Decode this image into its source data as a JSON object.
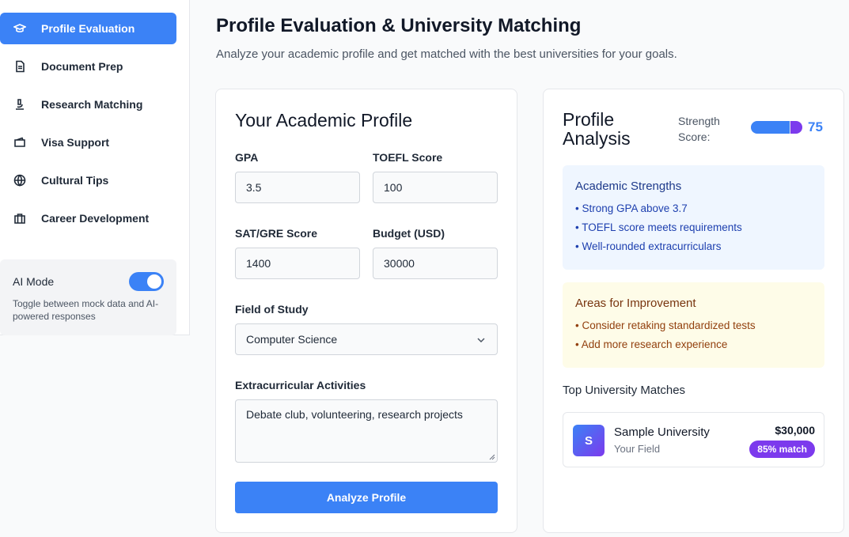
{
  "sidebar": {
    "items": [
      {
        "label": "Profile Evaluation",
        "icon": "graduation-cap-icon",
        "active": true
      },
      {
        "label": "Document Prep",
        "icon": "document-icon",
        "active": false
      },
      {
        "label": "Research Matching",
        "icon": "microscope-icon",
        "active": false
      },
      {
        "label": "Visa Support",
        "icon": "wallet-icon",
        "active": false
      },
      {
        "label": "Cultural Tips",
        "icon": "globe-icon",
        "active": false
      },
      {
        "label": "Career Development",
        "icon": "briefcase-icon",
        "active": false
      }
    ],
    "ai_mode": {
      "title": "AI Mode",
      "enabled": true,
      "description": "Toggle between mock data and AI-powered responses"
    }
  },
  "header": {
    "title": "Profile Evaluation & University Matching",
    "subtitle": "Analyze your academic profile and get matched with the best universities for your goals."
  },
  "form": {
    "title": "Your Academic Profile",
    "gpa": {
      "label": "GPA",
      "value": "3.5"
    },
    "toefl": {
      "label": "TOEFL Score",
      "value": "100"
    },
    "sat": {
      "label": "SAT/GRE Score",
      "value": "1400"
    },
    "budget": {
      "label": "Budget (USD)",
      "value": "30000"
    },
    "field": {
      "label": "Field of Study",
      "value": "Computer Science"
    },
    "extracurricular": {
      "label": "Extracurricular Activities",
      "value": "Debate club, volunteering, research projects"
    },
    "submit_label": "Analyze Profile"
  },
  "analysis": {
    "title": "Profile Analysis",
    "strength_label": "Strength Score:",
    "strength_score": "75",
    "strength_fraction": 0.75,
    "strengths": {
      "title": "Academic Strengths",
      "items": [
        "• Strong GPA above 3.7",
        "• TOEFL score meets requirements",
        "• Well-rounded extracurriculars"
      ]
    },
    "improvements": {
      "title": "Areas for Improvement",
      "items": [
        "• Consider retaking standardized tests",
        "• Add more research experience"
      ]
    },
    "matches_title": "Top University Matches",
    "matches": [
      {
        "initial": "S",
        "name": "Sample University",
        "field": "Your Field",
        "cost": "$30,000",
        "match": "85% match"
      }
    ]
  },
  "colors": {
    "accent": "#3b82f6",
    "purple": "#7c3aed"
  }
}
